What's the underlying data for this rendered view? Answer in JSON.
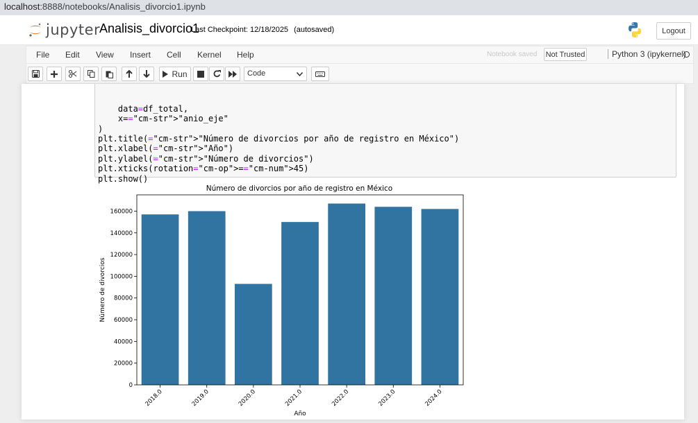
{
  "browser": {
    "url_host": "localhost",
    "url_path": ":8888/notebooks/Analisis_divorcio1.ipynb"
  },
  "header": {
    "logo_text": "jupyter",
    "notebook_name": "Analisis_divorcio1",
    "checkpoint_label": "Last Checkpoint:",
    "checkpoint_date": "12/18/2025",
    "autosave": "(autosaved)",
    "logout_label": "Logout"
  },
  "menubar": {
    "items": [
      "File",
      "Edit",
      "View",
      "Insert",
      "Cell",
      "Kernel",
      "Help"
    ],
    "notebook_saved": "Notebook saved",
    "not_trusted": "Not Trusted",
    "kernel": "Python 3 (ipykernel)"
  },
  "toolbar": {
    "run_label": "Run",
    "cell_type": "Code",
    "icons": [
      "save-icon",
      "plus-icon",
      "cut-icon",
      "copy-icon",
      "paste-icon",
      "arrow-up-icon",
      "arrow-down-icon",
      "play-icon",
      "stop-icon",
      "restart-icon",
      "fast-forward-icon",
      "keyboard-icon"
    ]
  },
  "code": {
    "lines": [
      "    data=df_total,",
      "    x=\"anio_eje\"",
      ")",
      "plt.title(\"Número de divorcios por año de registro en México\")",
      "plt.xlabel(\"Año\")",
      "plt.ylabel(\"Número de divorcios\")",
      "plt.xticks(rotation=45)",
      "plt.show()"
    ]
  },
  "chart_data": {
    "type": "bar",
    "title": "Número de divorcios por año de registro en México",
    "xlabel": "Año",
    "ylabel": "Número de divorcios",
    "categories": [
      "2018.0",
      "2019.0",
      "2020.0",
      "2021.0",
      "2022.0",
      "2023.0",
      "2024.0"
    ],
    "values": [
      157000,
      160000,
      93000,
      150000,
      167000,
      164000,
      162000
    ],
    "ylim": [
      0,
      175000
    ],
    "yticks": [
      0,
      20000,
      40000,
      60000,
      80000,
      100000,
      120000,
      140000,
      160000
    ],
    "bar_color": "#3274a1",
    "xtick_rotation": 45,
    "grid": false
  }
}
